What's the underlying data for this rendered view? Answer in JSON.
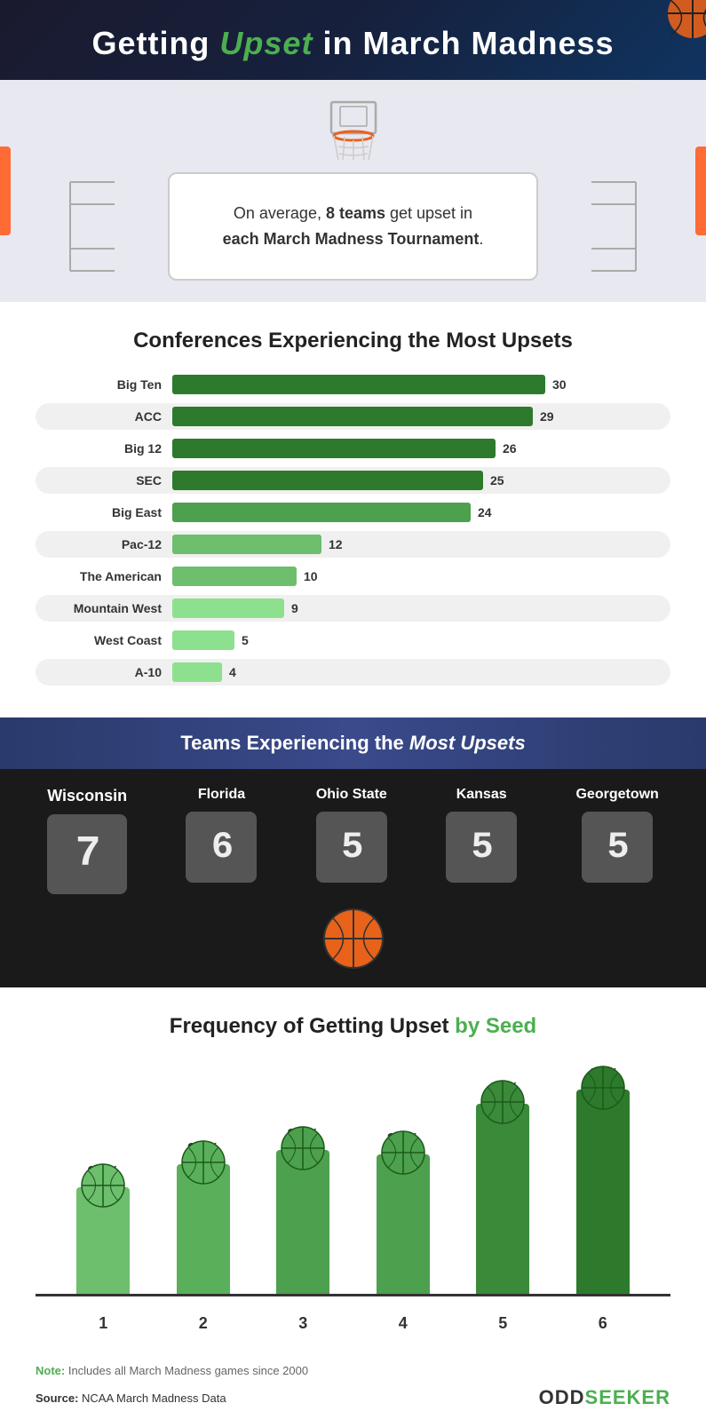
{
  "header": {
    "title_part1": "Getting ",
    "title_upset": "Upset",
    "title_part2": " in March Madness"
  },
  "intro": {
    "text1": "On average, ",
    "bold_teams": "8 teams",
    "text2": " get upset in",
    "text3": "each March Madness Tournament",
    "text4": "."
  },
  "conferences": {
    "title": "Conferences Experiencing the Most Upsets",
    "items": [
      {
        "name": "Big Ten",
        "value": 30,
        "max": 30,
        "shaded": false
      },
      {
        "name": "ACC",
        "value": 29,
        "max": 30,
        "shaded": true
      },
      {
        "name": "Big 12",
        "value": 26,
        "max": 30,
        "shaded": false
      },
      {
        "name": "SEC",
        "value": 25,
        "max": 30,
        "shaded": true
      },
      {
        "name": "Big East",
        "value": 24,
        "max": 30,
        "shaded": false
      },
      {
        "name": "Pac-12",
        "value": 12,
        "max": 30,
        "shaded": true
      },
      {
        "name": "The American",
        "value": 10,
        "max": 30,
        "shaded": false
      },
      {
        "name": "Mountain West",
        "value": 9,
        "max": 30,
        "shaded": true
      },
      {
        "name": "West Coast",
        "value": 5,
        "max": 30,
        "shaded": false
      },
      {
        "name": "A-10",
        "value": 4,
        "max": 30,
        "shaded": true
      }
    ]
  },
  "teams": {
    "title_part1": "Teams Experiencing the ",
    "title_italic": "Most Upsets",
    "items": [
      {
        "name": "Wisconsin",
        "score": "7",
        "highlight": true
      },
      {
        "name": "Florida",
        "score": "6",
        "highlight": false
      },
      {
        "name": "Ohio State",
        "score": "5",
        "highlight": false
      },
      {
        "name": "Kansas",
        "score": "5",
        "highlight": false
      },
      {
        "name": "Georgetown",
        "score": "5",
        "highlight": false
      }
    ]
  },
  "frequency": {
    "title_part1": "Frequency of Getting Upset ",
    "title_part2": "by Seed",
    "bars": [
      {
        "seed": "1",
        "pct": "23%",
        "value": 23,
        "color": "#6dbe6d"
      },
      {
        "seed": "2",
        "pct": "28%",
        "value": 28,
        "color": "#5ab05a"
      },
      {
        "seed": "3",
        "pct": "31%",
        "value": 31,
        "color": "#4da04d"
      },
      {
        "seed": "4",
        "pct": "30%",
        "value": 30,
        "color": "#4da04d"
      },
      {
        "seed": "5",
        "pct": "41%",
        "value": 41,
        "color": "#3a8a3a"
      },
      {
        "seed": "6",
        "pct": "44%",
        "value": 44,
        "color": "#2d7a2d"
      }
    ]
  },
  "footer": {
    "note_label": "Note:",
    "note_text": " Includes all March Madness games since 2000",
    "source_label": "Source:",
    "source_text": " NCAA March Madness Data",
    "brand_odd": "ODD",
    "brand_seeker": "SEEKER"
  },
  "colors": {
    "green_dark": "#2d7a2d",
    "green_mid": "#3a8a3a",
    "green_light": "#6dbe6d",
    "bar_dark": "#1e7e1e",
    "bar_mid": "#28a428",
    "bar_light": "#6dbe6d"
  }
}
